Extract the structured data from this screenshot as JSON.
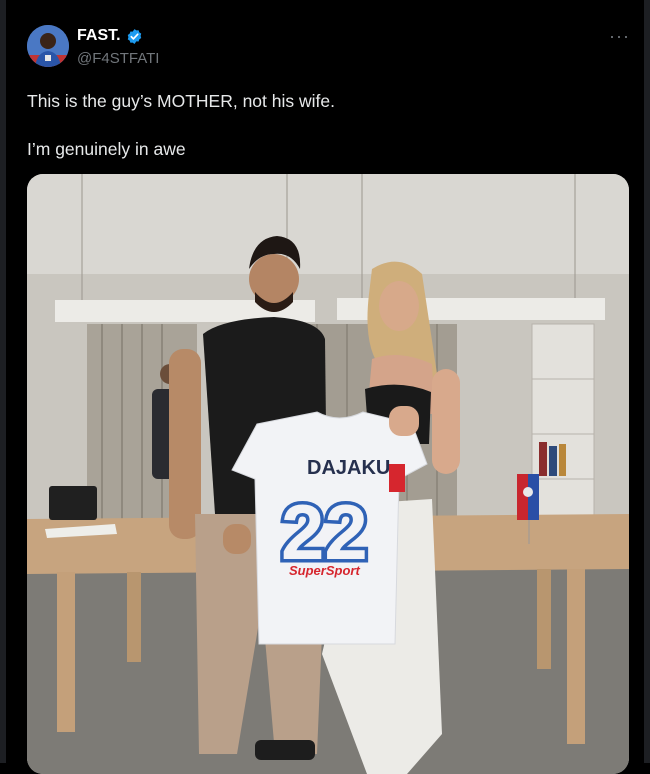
{
  "tweet": {
    "display_name": "FAST.",
    "handle": "@F4STFATI",
    "more_label": "···",
    "text": "This is the guy’s MOTHER, not his wife.\n\nI’m genuinely in awe",
    "media": {
      "jersey_name": "DAJAKU",
      "jersey_number": "22",
      "jersey_sponsor": "SuperSport"
    }
  },
  "colors": {
    "background": "#000000",
    "verified": "#1d9bf0",
    "secondary_text": "#71767b",
    "jersey_blue": "#2f62b6",
    "sponsor_red": "#d6262e"
  }
}
